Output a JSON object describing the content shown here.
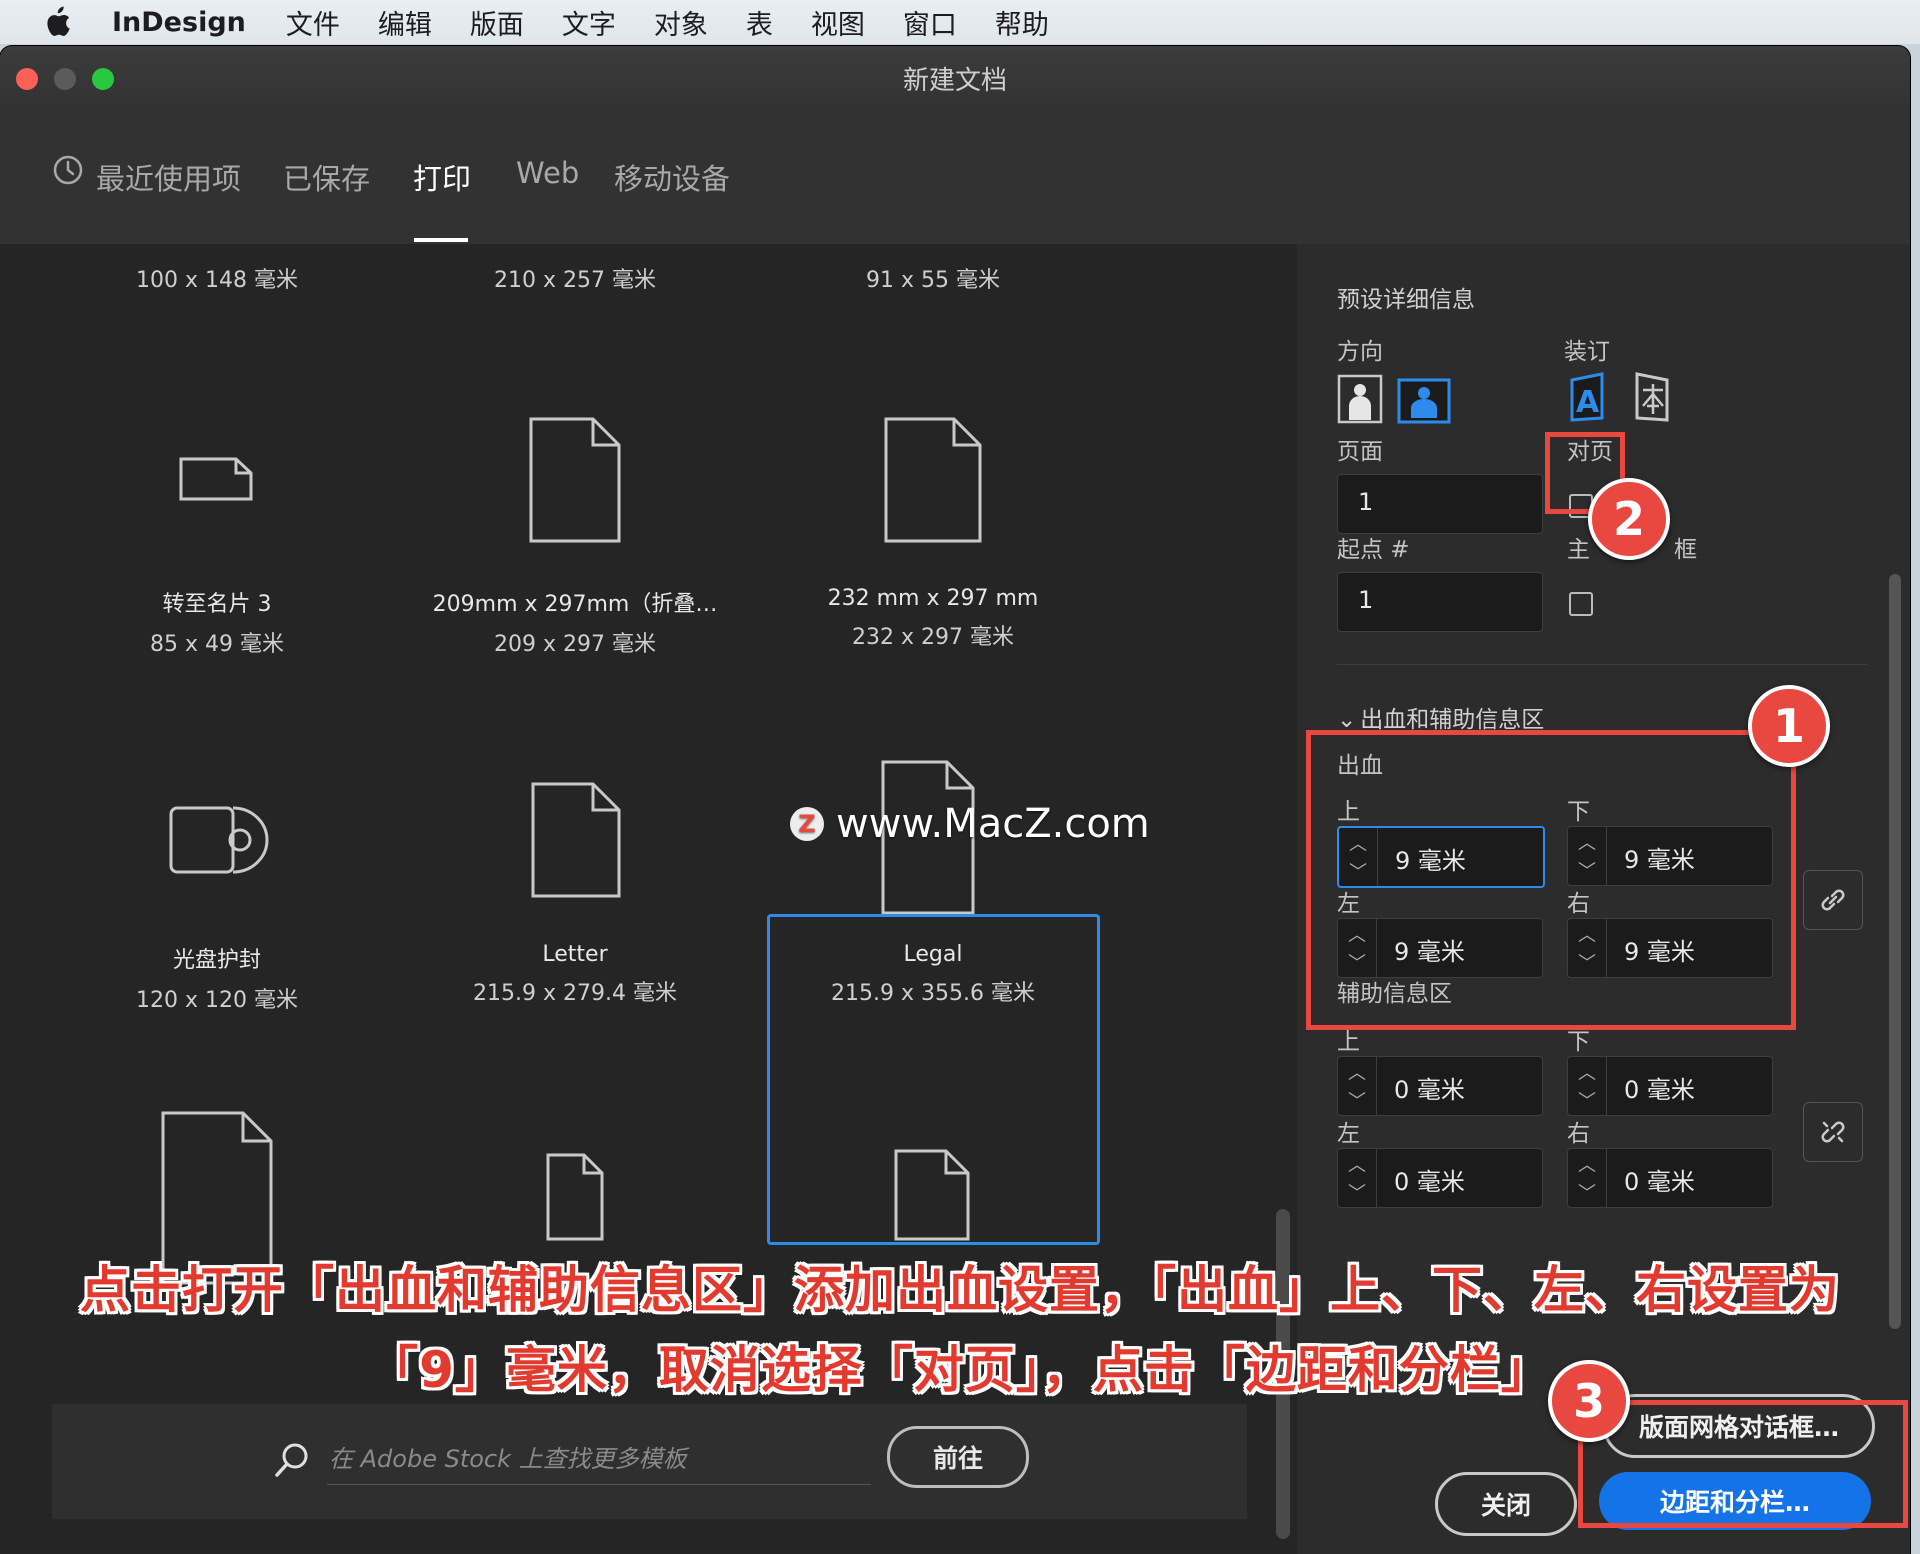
{
  "menubar": {
    "app_name": "InDesign",
    "items": [
      "文件",
      "编辑",
      "版面",
      "文字",
      "对象",
      "表",
      "视图",
      "窗口",
      "帮助"
    ]
  },
  "window": {
    "title": "新建文档"
  },
  "tabs": [
    {
      "label": "最近使用项",
      "active": false
    },
    {
      "label": "已保存",
      "active": false
    },
    {
      "label": "打印",
      "active": true
    },
    {
      "label": "Web",
      "active": false
    },
    {
      "label": "移动设备",
      "active": false
    }
  ],
  "templates": [
    {
      "name": "",
      "dims": "100 x 148 毫米"
    },
    {
      "name": "",
      "dims": "210 x 257 毫米"
    },
    {
      "name": "",
      "dims": "91 x 55 毫米"
    },
    {
      "name": "转至名片 3",
      "dims": "85 x 49 毫米"
    },
    {
      "name": "209mm x 297mm（折叠…",
      "dims": "209 x 297 毫米"
    },
    {
      "name": "232 mm x 297 mm",
      "dims": "232 x 297 毫米"
    },
    {
      "name": "光盘护封",
      "dims": "120 x 120 毫米"
    },
    {
      "name": "Letter",
      "dims": "215.9 x 279.4 毫米"
    },
    {
      "name": "Legal",
      "dims": "215.9 x 355.6 毫米",
      "selected": true
    }
  ],
  "search": {
    "placeholder": "在 Adobe Stock 上查找更多模板",
    "go_label": "前往"
  },
  "preset": {
    "title": "预设详细信息",
    "orientation_label": "方向",
    "binding_label": "装订",
    "pages_label": "页面",
    "pages_value": "1",
    "facing_label": "对页",
    "facing_checked": false,
    "start_label": "起点 #",
    "start_value": "1",
    "primary_label": "主",
    "primary_label_tail": "框",
    "primary_checked": false
  },
  "bleed_section": {
    "title": "出血和辅助信息区",
    "bleed_label": "出血",
    "top_label": "上",
    "bottom_label": "下",
    "left_label": "左",
    "right_label": "右",
    "top": "9 毫米",
    "bottom": "9 毫米",
    "left": "9 毫米",
    "right": "9 毫米",
    "slug_label": "辅助信息区",
    "slug_top": "0 毫米",
    "slug_bottom": "0 毫米",
    "slug_left": "0 毫米",
    "slug_right": "0 毫米"
  },
  "buttons": {
    "layout_grid": "版面网格对话框…",
    "close": "关闭",
    "margins_columns": "边距和分栏…"
  },
  "annotations": {
    "badge1": "1",
    "badge2": "2",
    "badge3": "3",
    "caption_line1": "点击打开「出血和辅助信息区」添加出血设置，「出血」上、下、左、右设置为",
    "caption_line2": "「9」毫米，取消选择「对页」，点击「边距和分栏」",
    "watermark": "www.MacZ.com",
    "watermark_logo": "Z",
    "color": "#e8483f"
  },
  "colors": {
    "accent": "#1473e6",
    "selection": "#2d8ceb"
  }
}
